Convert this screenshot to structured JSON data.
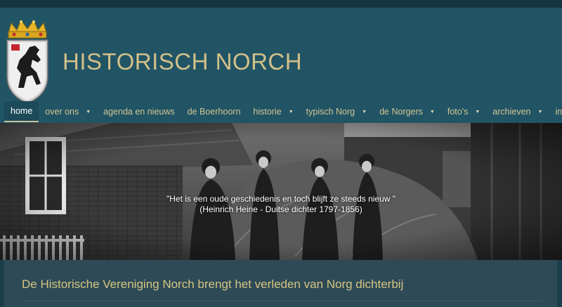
{
  "site": {
    "title": "HISTORISCH NORCH"
  },
  "nav": {
    "items": [
      {
        "label": "home",
        "active": true,
        "has_dropdown": false
      },
      {
        "label": "over ons",
        "active": false,
        "has_dropdown": true
      },
      {
        "label": "agenda en nieuws",
        "active": false,
        "has_dropdown": false
      },
      {
        "label": "de Boerhoorn",
        "active": false,
        "has_dropdown": false
      },
      {
        "label": "historie",
        "active": false,
        "has_dropdown": true
      },
      {
        "label": "typisch Norg",
        "active": false,
        "has_dropdown": true
      },
      {
        "label": "de Norgers",
        "active": false,
        "has_dropdown": true
      },
      {
        "label": "foto's",
        "active": false,
        "has_dropdown": true
      },
      {
        "label": "archieven",
        "active": false,
        "has_dropdown": true
      },
      {
        "label": "index",
        "active": false,
        "has_dropdown": false
      }
    ],
    "caret_glyph": "▼"
  },
  "hero": {
    "quote_line1": "\"Het is een oude geschiedenis en toch blijft ze steeds nieuw \"",
    "quote_line2": "(Heinrich Heine - Duitse dichter 1797-1856)"
  },
  "main": {
    "heading": "De Historische Vereniging Norch brengt het verleden van Norg dichterbij"
  },
  "colors": {
    "header_bg": "#215465",
    "title_gold": "#d2c089",
    "nav_text": "#d3c691",
    "content_bg": "#2d4a56"
  },
  "icons": {
    "crest": "coat-of-arms-icon"
  }
}
